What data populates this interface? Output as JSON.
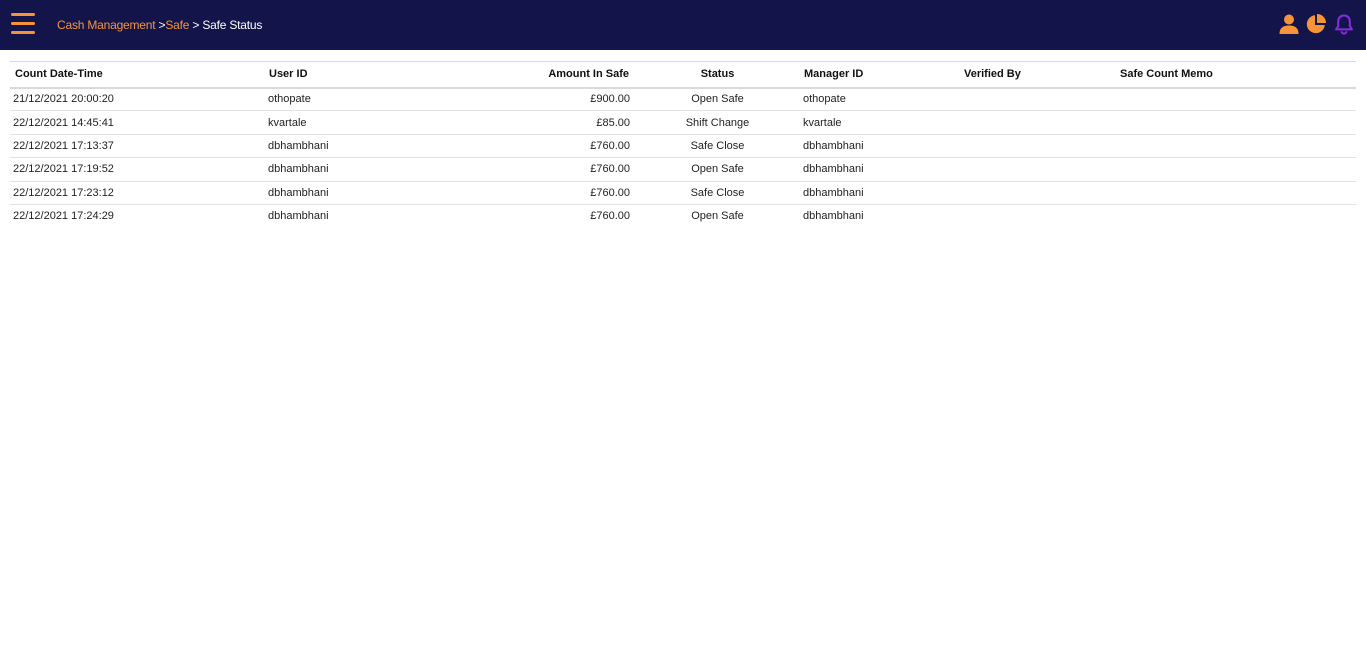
{
  "header": {
    "breadcrumb": [
      {
        "label": "Cash Management",
        "link": true
      },
      {
        "label": "Safe",
        "link": true
      },
      {
        "label": "Safe Status",
        "link": false
      }
    ],
    "separator": ">",
    "icons": [
      "user-icon",
      "pie-chart-icon",
      "bell-icon"
    ],
    "colors": {
      "bar": "#13144a",
      "accent": "#f7943a",
      "bell": "#8a2be2"
    }
  },
  "table": {
    "columns": [
      "Count Date-Time",
      "User ID",
      "Amount In Safe",
      "Status",
      "Manager ID",
      "Verified By",
      "Safe Count Memo"
    ],
    "rows": [
      [
        "21/12/2021 20:00:20",
        "othopate",
        "£900.00",
        "Open Safe",
        "othopate",
        "",
        ""
      ],
      [
        "22/12/2021 14:45:41",
        "kvartale",
        "£85.00",
        "Shift Change",
        "kvartale",
        "",
        ""
      ],
      [
        "22/12/2021 17:13:37",
        "dbhambhani",
        "£760.00",
        "Safe Close",
        "dbhambhani",
        "",
        ""
      ],
      [
        "22/12/2021 17:19:52",
        "dbhambhani",
        "£760.00",
        "Open Safe",
        "dbhambhani",
        "",
        ""
      ],
      [
        "22/12/2021 17:23:12",
        "dbhambhani",
        "£760.00",
        "Safe Close",
        "dbhambhani",
        "",
        ""
      ],
      [
        "22/12/2021 17:24:29",
        "dbhambhani",
        "£760.00",
        "Open Safe",
        "dbhambhani",
        "",
        ""
      ]
    ]
  }
}
